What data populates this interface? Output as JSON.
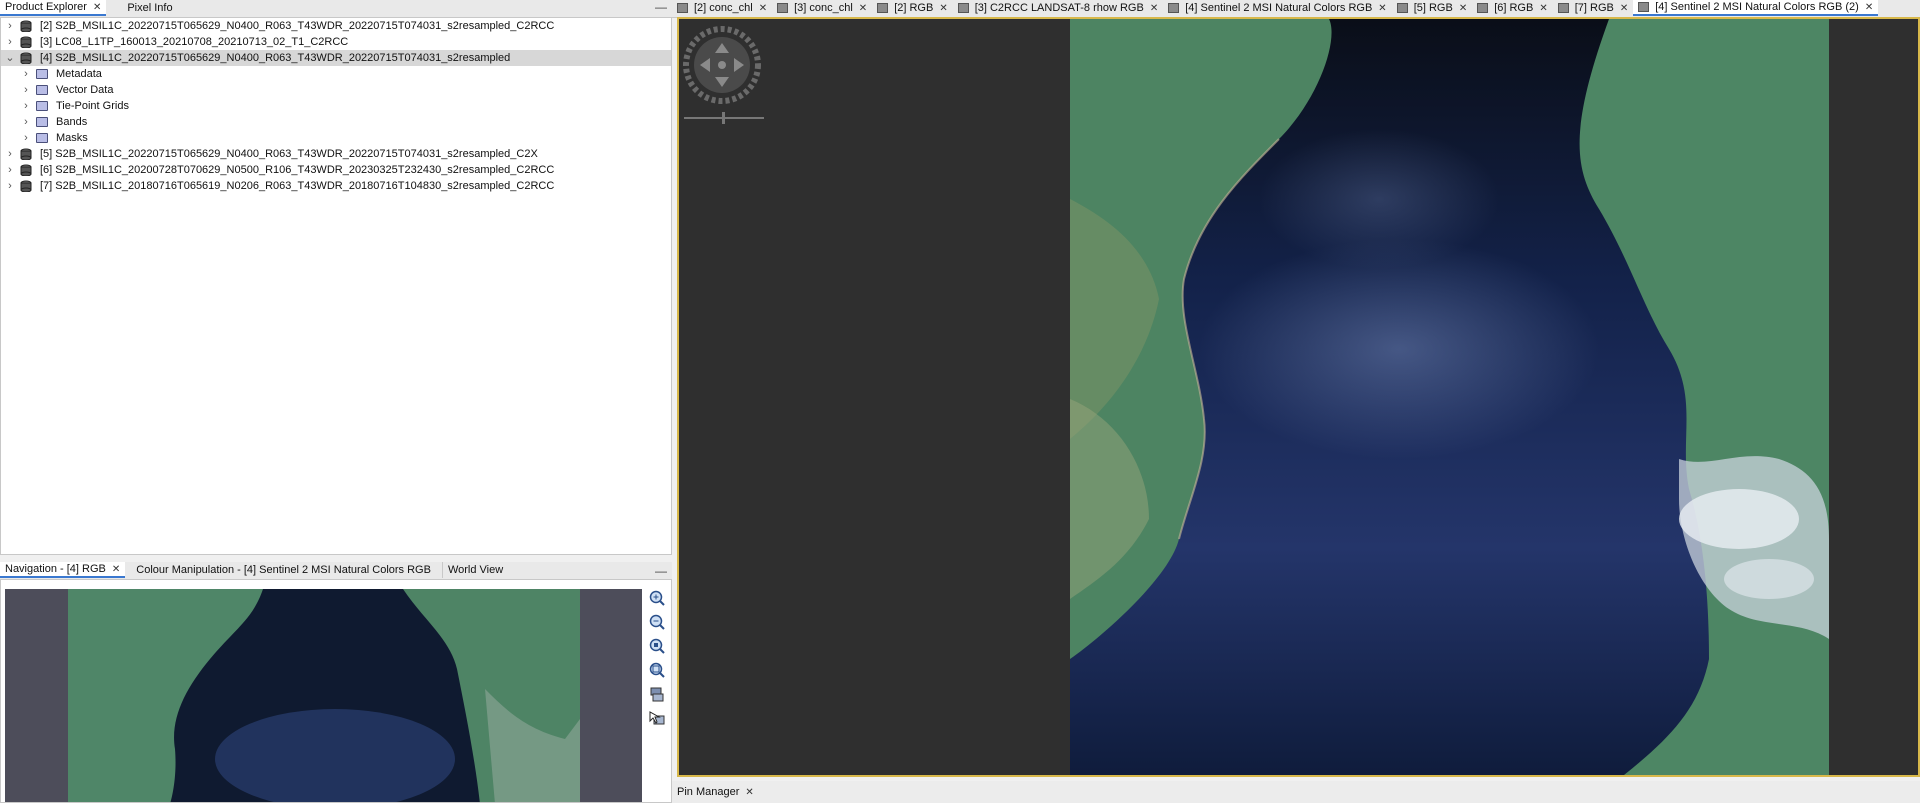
{
  "left_tabs": [
    {
      "label": "Product Explorer",
      "active": true
    },
    {
      "label": "Pixel Info",
      "active": false
    }
  ],
  "tree": {
    "products": [
      {
        "label": "[2] S2B_MSIL1C_20220715T065629_N0400_R063_T43WDR_20220715T074031_s2resampled_C2RCC",
        "expanded": false
      },
      {
        "label": "[3] LC08_L1TP_160013_20210708_20210713_02_T1_C2RCC",
        "expanded": false
      },
      {
        "label": "[4] S2B_MSIL1C_20220715T065629_N0400_R063_T43WDR_20220715T074031_s2resampled",
        "expanded": true,
        "selected": true
      },
      {
        "label": "[5] S2B_MSIL1C_20220715T065629_N0400_R063_T43WDR_20220715T074031_s2resampled_C2X",
        "expanded": false
      },
      {
        "label": "[6] S2B_MSIL1C_20200728T070629_N0500_R106_T43WDR_20230325T232430_s2resampled_C2RCC",
        "expanded": false
      },
      {
        "label": "[7] S2B_MSIL1C_20180716T065619_N0206_R063_T43WDR_20180716T104830_s2resampled_C2RCC",
        "expanded": false
      }
    ],
    "children": [
      "Metadata",
      "Vector Data",
      "Tie-Point Grids",
      "Bands",
      "Masks"
    ]
  },
  "bottom_tabs": [
    {
      "label": "Navigation - [4] RGB",
      "active": true,
      "closable": true
    },
    {
      "label": "Colour Manipulation - [4] Sentinel 2 MSI Natural Colors RGB",
      "active": false,
      "closable": false
    },
    {
      "label": "World View",
      "active": false,
      "closable": false
    }
  ],
  "nav_tools": [
    "zoom-in-icon",
    "zoom-out-icon",
    "zoom-pixel-icon",
    "zoom-all-icon",
    "sync-views-icon",
    "sync-cursor-icon"
  ],
  "image_tabs": [
    {
      "label": "[2] conc_chl",
      "active": false
    },
    {
      "label": "[3] conc_chl",
      "active": false
    },
    {
      "label": "[2] RGB",
      "active": false
    },
    {
      "label": "[3] C2RCC LANDSAT-8 rhow RGB",
      "active": false
    },
    {
      "label": "[4] Sentinel 2 MSI Natural Colors RGB",
      "active": false
    },
    {
      "label": "[5] RGB",
      "active": false
    },
    {
      "label": "[6] RGB",
      "active": false
    },
    {
      "label": "[7] RGB",
      "active": false
    },
    {
      "label": "[4] Sentinel 2 MSI Natural Colors RGB (2)",
      "active": true
    }
  ],
  "pin_manager": {
    "label": "Pin Manager"
  },
  "minimize_glyph": "—",
  "close_glyph": "✕",
  "colors": {
    "accent": "#3a78d0",
    "view_border": "#d8b84a",
    "water": "#0c1628",
    "land": "#4a7f5c"
  }
}
